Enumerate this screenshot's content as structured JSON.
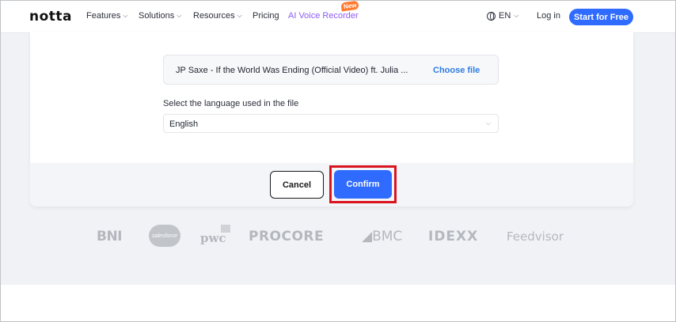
{
  "nav": {
    "logo": "notta",
    "items": [
      {
        "label": "Features",
        "chevron": "chevron-down-icon"
      },
      {
        "label": "Solutions",
        "chevron": "chevron-down-icon"
      },
      {
        "label": "Resources",
        "chevron": "chevron-down-icon"
      },
      {
        "label": "Pricing"
      }
    ],
    "ai_recorder": "AI Voice Recorder",
    "new_badge": "New",
    "language": "EN",
    "login": "Log in",
    "start_button": "Start for Free",
    "colors": {
      "accent": "#2f6bff",
      "ai_label": "#8a5cf6",
      "badge": "#ff7a2f"
    }
  },
  "dialog": {
    "file_name": "JP Saxe - If the World Was Ending (Official Video) ft. Julia ...",
    "choose_file": "Choose file",
    "language_label": "Select the language used in the file",
    "language_value": "English",
    "cancel": "Cancel",
    "confirm": "Confirm",
    "highlight_color": "#d9141e"
  },
  "logos": {
    "bni": "BNI",
    "salesforce": "salesforce",
    "pwc": "pwc",
    "procore": "PROCORE",
    "bmc": "BMC",
    "idexx": "IDEXX",
    "feedvisor": "Feedvisor"
  }
}
